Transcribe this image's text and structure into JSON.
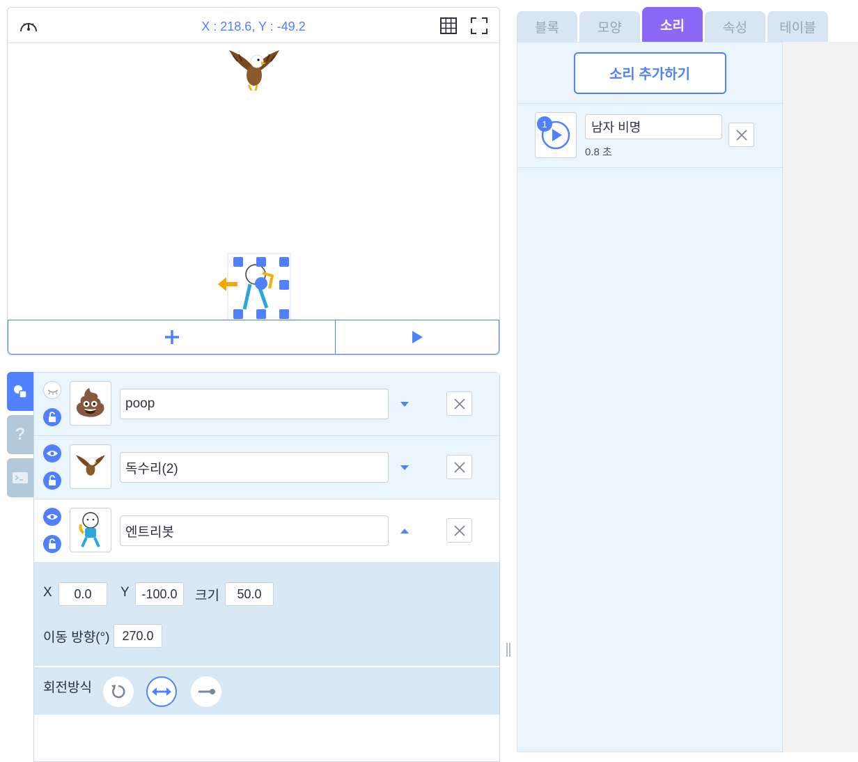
{
  "stage": {
    "coordinates": "X : 218.6, Y : -49.2",
    "icons": [
      "speed-icon",
      "grid-icon",
      "fullscreen-icon",
      "add-icon",
      "play-icon"
    ]
  },
  "objects": [
    {
      "name": "poop",
      "visible": false,
      "locked": false,
      "emoji": "💩",
      "expanded": false
    },
    {
      "name": "독수리(2)",
      "visible": true,
      "locked": false,
      "emoji": "🦅",
      "expanded": false
    },
    {
      "name": "엔트리봇",
      "visible": true,
      "locked": false,
      "emoji": "",
      "expanded": true
    }
  ],
  "props": {
    "x_label": "X",
    "x_value": "0.0",
    "y_label": "Y",
    "y_value": "-100.0",
    "size_label": "크기",
    "size_value": "50.0",
    "direction_label": "이동 방향(°)",
    "direction_value": "270.0",
    "rotation_label": "회전방식"
  },
  "tabs": [
    "블록",
    "모양",
    "소리",
    "속성",
    "테이블"
  ],
  "active_tab": "소리",
  "sound": {
    "add_label": "소리 추가하기",
    "items": [
      {
        "index": "1",
        "name": "남자 비명",
        "duration": "0.8 초"
      }
    ]
  },
  "colors": {
    "accent": "#4f80ff",
    "active_tab": "#8c68f6",
    "panel_bg": "#eaf5fd"
  }
}
